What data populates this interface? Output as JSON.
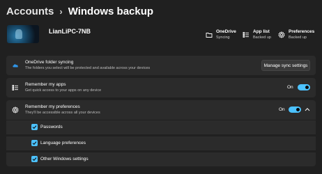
{
  "breadcrumb": {
    "parent": "Accounts",
    "separator": "›",
    "current": "Windows backup"
  },
  "device": {
    "name": "LianLiPC-7NB"
  },
  "summary": [
    {
      "icon": "folder-icon",
      "title": "OneDrive",
      "subtitle": "Syncing"
    },
    {
      "icon": "app-list-icon",
      "title": "App list",
      "subtitle": "Backed up"
    },
    {
      "icon": "gear-icon",
      "title": "Preferences",
      "subtitle": "Backed up"
    }
  ],
  "onedrive": {
    "icon": "cloud-icon",
    "title": "OneDrive folder syncing",
    "subtitle": "The folders you select will be protected and available across your devices",
    "button": "Manage sync settings"
  },
  "apps": {
    "icon": "app-list-icon",
    "title": "Remember my apps",
    "subtitle": "Get quick access to your apps on any device",
    "toggle_label": "On",
    "toggle_on": true
  },
  "preferences": {
    "icon": "gear-icon",
    "title": "Remember my preferences",
    "subtitle": "They'll be accessible across all your devices",
    "toggle_label": "On",
    "toggle_on": true,
    "options": [
      {
        "label": "Passwords",
        "checked": true
      },
      {
        "label": "Language preferences",
        "checked": true
      },
      {
        "label": "Other Windows settings",
        "checked": true
      }
    ]
  },
  "colors": {
    "accent": "#4cc2ff",
    "background": "#202020",
    "card": "#2b2b2b"
  }
}
